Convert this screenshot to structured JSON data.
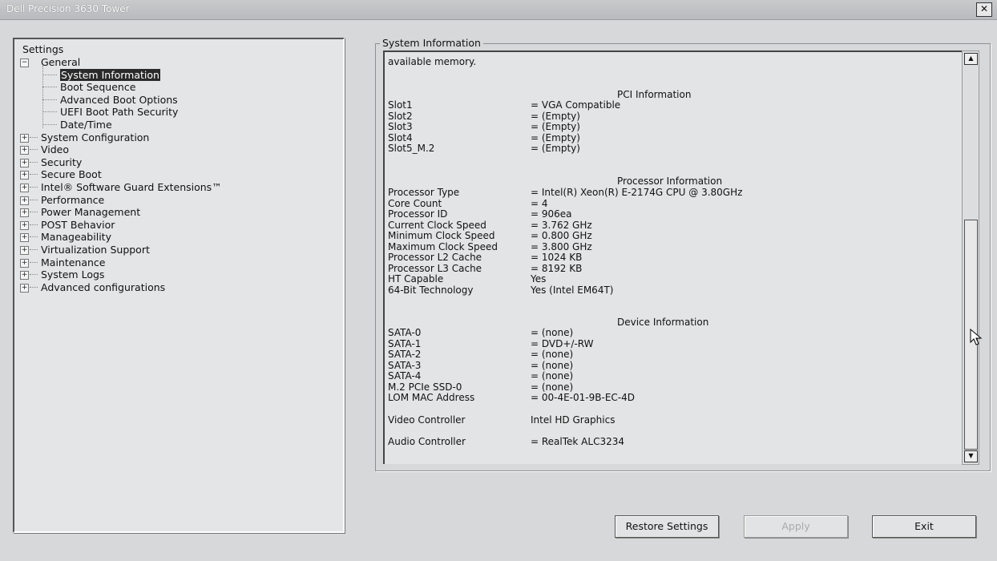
{
  "window": {
    "title": "Dell Precision 3630 Tower",
    "close_label": "✕"
  },
  "tree": {
    "root_label": "Settings",
    "general": {
      "label": "General",
      "children": [
        "System Information",
        "Boot Sequence",
        "Advanced Boot Options",
        "UEFI Boot Path Security",
        "Date/Time"
      ],
      "selected": "System Information"
    },
    "categories": [
      "System Configuration",
      "Video",
      "Security",
      "Secure Boot",
      "Intel® Software Guard Extensions™",
      "Performance",
      "Power Management",
      "POST Behavior",
      "Manageability",
      "Virtualization Support",
      "Maintenance",
      "System Logs",
      "Advanced configurations"
    ]
  },
  "info": {
    "legend": "System Information",
    "top_text": "available memory.",
    "pci": {
      "heading": "PCI Information",
      "rows": [
        [
          "Slot1",
          "= VGA Compatible"
        ],
        [
          "Slot2",
          "= (Empty)"
        ],
        [
          "Slot3",
          "= (Empty)"
        ],
        [
          "Slot4",
          "= (Empty)"
        ],
        [
          "Slot5_M.2",
          "= (Empty)"
        ]
      ]
    },
    "processor": {
      "heading": "Processor Information",
      "rows": [
        [
          "Processor Type",
          "= Intel(R) Xeon(R) E-2174G CPU @ 3.80GHz"
        ],
        [
          "Core Count",
          "= 4"
        ],
        [
          "Processor ID",
          "= 906ea"
        ],
        [
          "Current Clock Speed",
          "= 3.762 GHz"
        ],
        [
          "Minimum Clock Speed",
          "= 0.800 GHz"
        ],
        [
          "Maximum Clock Speed",
          "= 3.800 GHz"
        ],
        [
          "Processor L2 Cache",
          "= 1024 KB"
        ],
        [
          "Processor L3 Cache",
          "= 8192 KB"
        ],
        [
          "HT Capable",
          "Yes"
        ],
        [
          "64-Bit Technology",
          "Yes (Intel EM64T)"
        ]
      ]
    },
    "device": {
      "heading": "Device Information",
      "rows": [
        [
          "SATA-0",
          "= (none)"
        ],
        [
          "SATA-1",
          "= DVD+/-RW"
        ],
        [
          "SATA-2",
          "= (none)"
        ],
        [
          "SATA-3",
          "= (none)"
        ],
        [
          "SATA-4",
          "= (none)"
        ],
        [
          "M.2 PCIe SSD-0",
          "= (none)"
        ],
        [
          "LOM MAC Address",
          "= 00-4E-01-9B-EC-4D"
        ]
      ],
      "video_label": "Video Controller",
      "video_value": "Intel HD Graphics",
      "audio_label": "Audio Controller",
      "audio_value": "= RealTek ALC3234"
    }
  },
  "buttons": {
    "restore": "Restore Settings",
    "apply": "Apply",
    "exit": "Exit"
  },
  "icons": {
    "close": "close-icon",
    "scroll_up": "arrow-up-icon",
    "scroll_down": "arrow-down-icon",
    "cursor": "mouse-pointer-icon"
  }
}
